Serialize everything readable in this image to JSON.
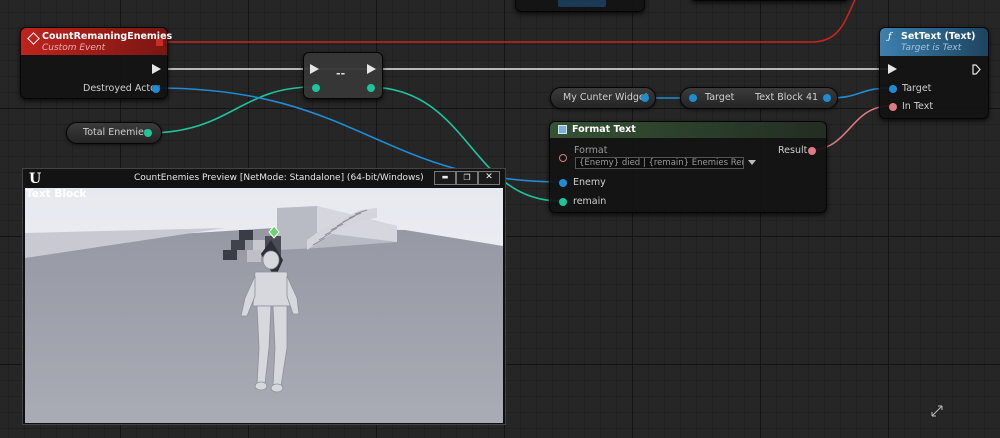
{
  "event_node": {
    "title": "CountRemaningEnemies",
    "subtitle": "Custom Event",
    "pin_destroyed_actor": "Destroyed Actor"
  },
  "total_enemies_var": {
    "label": "Total Enemies"
  },
  "tostring_node": {
    "symbol": "--"
  },
  "widget_var": {
    "label": "My Cunter Widget"
  },
  "get_text_block": {
    "target_label": "Target",
    "output_label": "Text Block 41"
  },
  "format_node": {
    "title": "Format Text",
    "format_label": "Format",
    "format_value": "{Enemy} died | {remain} Enemies Remain.",
    "result_label": "Result",
    "pin_enemy": "Enemy",
    "pin_remain": "remain"
  },
  "settext_node": {
    "title": "SetText (Text)",
    "subtitle": "Target is Text",
    "pin_target": "Target",
    "pin_intext": "In Text"
  },
  "preview_window": {
    "title": "CountEnemies Preview [NetMode: Standalone] (64-bit/Windows)",
    "logo": "U",
    "widget_text": "Text Block",
    "minimize": "▬",
    "maximize": "❐",
    "close": "✕"
  },
  "colors": {
    "event_header": "#b8231e",
    "function_header": "#2e6a8f",
    "pure_header": "#2b3a2b",
    "object_wire": "#1e8cd4",
    "text_wire": "#de7a83",
    "int_wire": "#1ec49a",
    "string_wire": "#e03ae0",
    "exec_wire": "#ffffff"
  }
}
